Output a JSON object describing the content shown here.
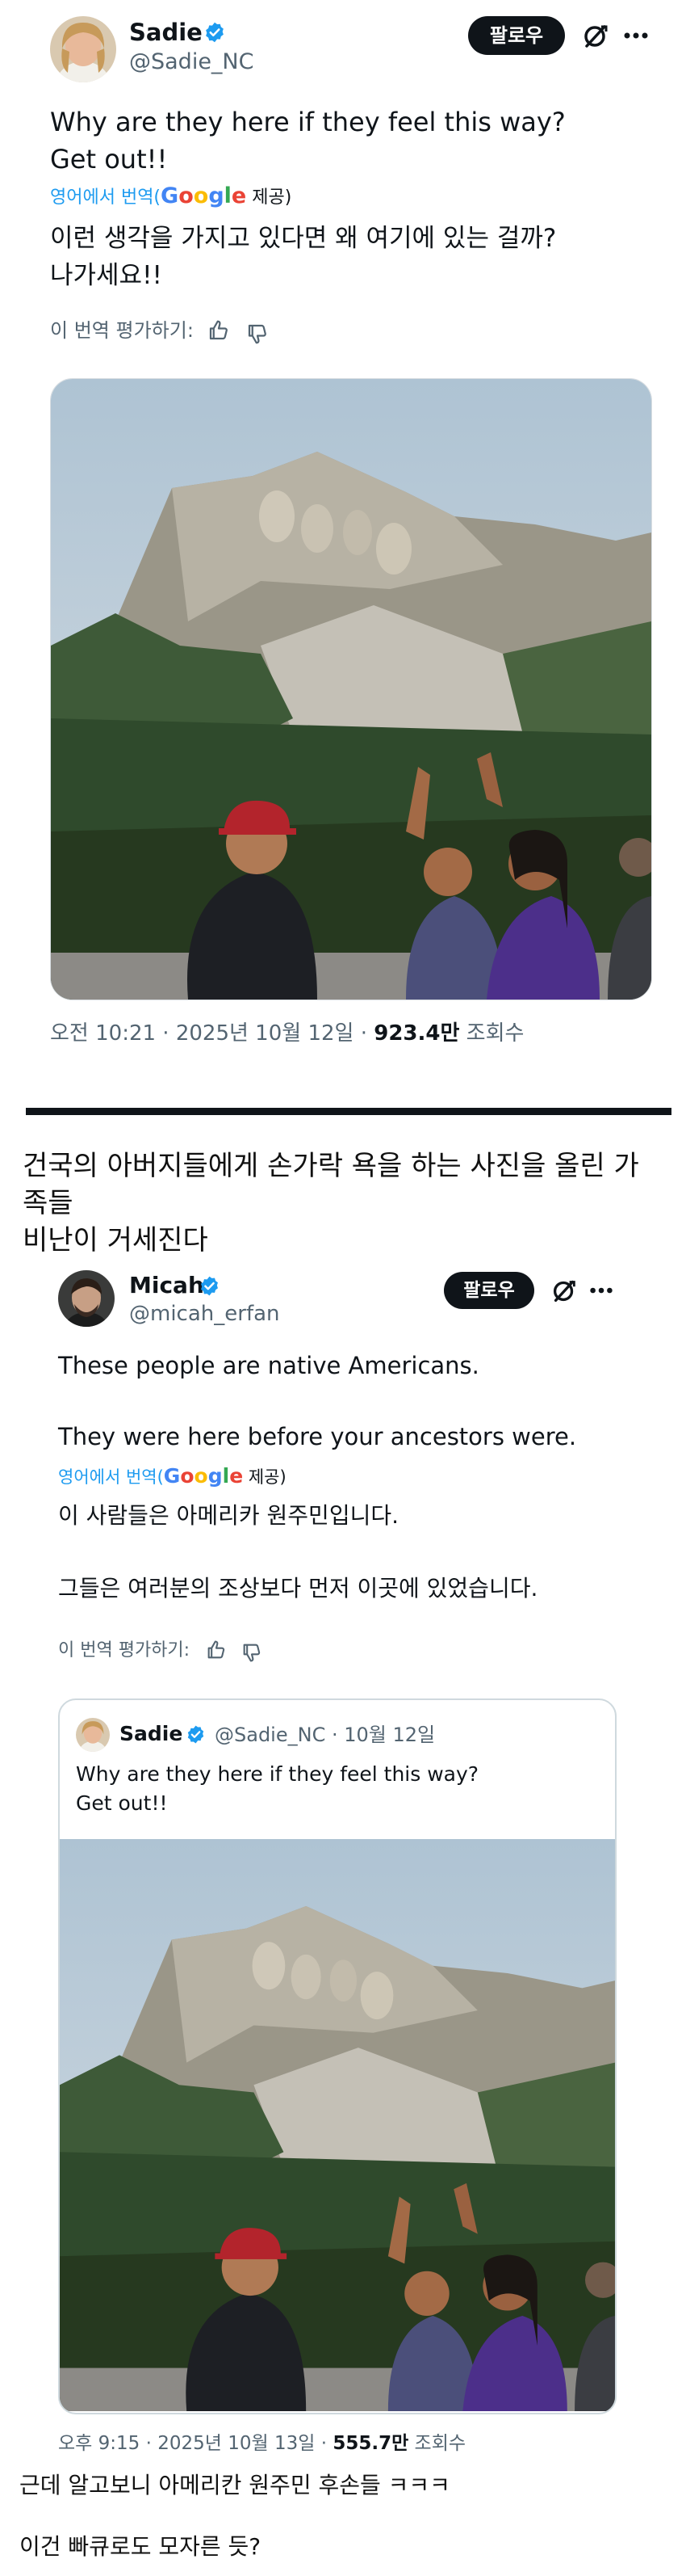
{
  "post1": {
    "name": "Sadie",
    "handle": "@Sadie_NC",
    "follow": "팔로우",
    "text_line1": "Why are they here if they feel this way?",
    "text_line2": "Get out!!",
    "translated_prefix": "영어에서 번역(",
    "translated_suffix": " 제공)",
    "google": "Google",
    "trans_line1": "이런 생각을 가지고 있다면 왜 여기에 있는 걸까?",
    "trans_line2": "나가세요!!",
    "rate": "이 번역 평가하기:",
    "time": "오전 10:21 · 2025년 10월 12일 · ",
    "views": "923.4만",
    "views_label": " 조회수"
  },
  "headline": {
    "line1": "건국의 아버지들에게 손가락 욕을 하는 사진을 올린 가",
    "line2": "족들",
    "line3": "비난이 거세진다"
  },
  "post2": {
    "name": "Micah",
    "handle": "@micah_erfan",
    "follow": "팔로우",
    "text_line1": "These people are native Americans.",
    "text_line2": "They were here before your ancestors were.",
    "translated_prefix": "영어에서 번역(",
    "translated_suffix": " 제공)",
    "google": "Google",
    "trans_line1": "이 사람들은 아메리카 원주민입니다.",
    "trans_line2": "그들은 여러분의 조상보다 먼저 이곳에 있었습니다.",
    "rate": "이 번역 평가하기:",
    "time": "오후 9:15 · 2025년 10월 13일 · ",
    "views": "555.7만",
    "views_label": " 조회수"
  },
  "quote": {
    "name": "Sadie",
    "meta": "@Sadie_NC · 10월 12일",
    "text_line1": "Why are they here if they feel this way?",
    "text_line2": "Get out!!"
  },
  "comments": {
    "line1": "근데 알고보니 아메리칸 원주민 후손들 ㅋㅋㅋ",
    "line2": "이건 빠큐로도 모자른 듯?"
  },
  "icons": {
    "verified": "verified-badge-icon",
    "grok": "grok-icon",
    "more": "more-icon",
    "thumbs_up": "thumbs-up-icon",
    "thumbs_down": "thumbs-down-icon"
  },
  "colors": {
    "accent": "#1d9bf0",
    "text": "#0f1419",
    "muted": "#536471"
  }
}
